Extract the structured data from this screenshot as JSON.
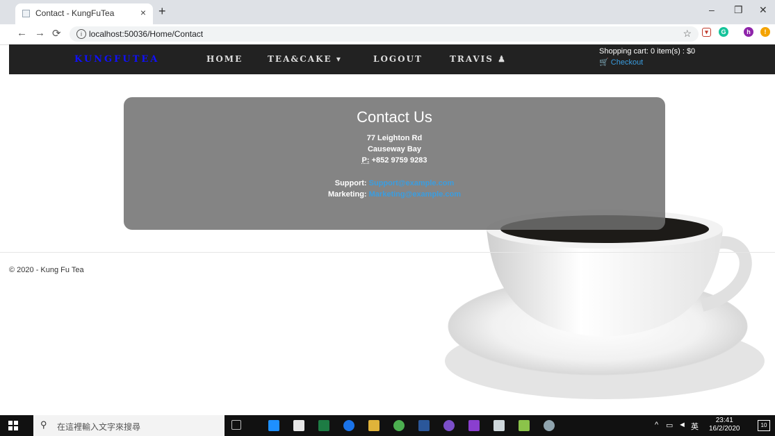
{
  "browser": {
    "tab_title": "Contact - KungFuTea",
    "tab_close": "×",
    "new_tab": "+",
    "url": "localhost:50036/Home/Contact"
  },
  "navbar": {
    "brand": "KUNGFUTEA",
    "links": [
      "HOME",
      "TEA&CAKE ▾",
      "LOGOUT",
      "TRAVIS"
    ],
    "cart_text": "Shopping cart: 0 item(s) : $0",
    "checkout": "Checkout"
  },
  "contact": {
    "title": "Contact Us",
    "address_line1": "77 Leighton Rd",
    "address_line2": "Causeway Bay",
    "phone_label": "P:",
    "phone": "+852 9759 9283",
    "support_label": "Support:",
    "support_email": "Support@example.com",
    "marketing_label": "Marketing:",
    "marketing_email": "Marketing@example.com"
  },
  "footer": {
    "text": "© 2020 - Kung Fu Tea"
  },
  "taskbar": {
    "search_placeholder": "在這裡輸入文字來搜尋",
    "ime": "英",
    "time": "23:41",
    "date": "16/2/2020",
    "notif_count": "10"
  },
  "colors": {
    "navbar_bg": "#222222",
    "brand": "#1010ff",
    "link": "#3a9de0",
    "panel_bg": "#6e6e6e"
  }
}
